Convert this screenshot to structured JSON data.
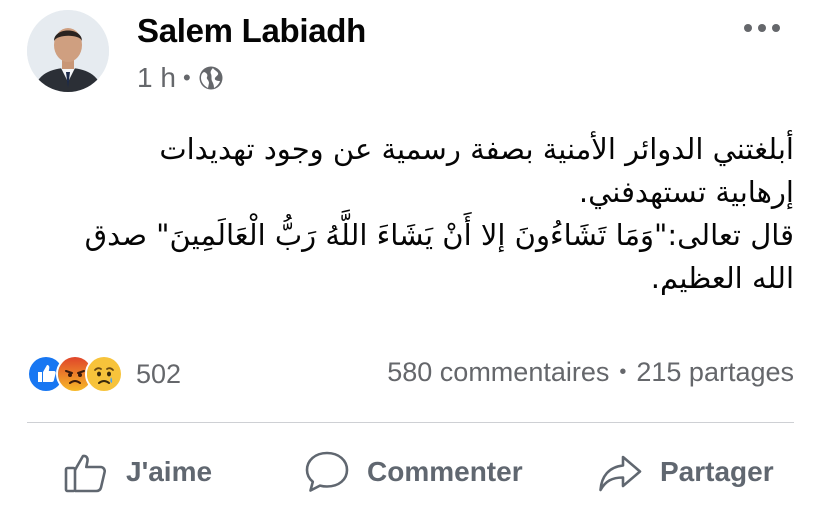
{
  "post": {
    "author": "Salem Labiadh",
    "time": "1 h",
    "separator": "•",
    "audience_icon": "globe-icon",
    "more_icon": "more-horizontal-icon",
    "body": "أبلغتني الدوائر الأمنية بصفة رسمية عن وجود تهديدات\nإرهابية تستهدفني.\nقال تعالى:\"وَمَا تَشَاءُونَ إلا أَنْ يَشَاءَ اللَّهُ رَبُّ الْعَالَمِينَ\" صدق\nالله العظيم."
  },
  "reactions": {
    "icons": [
      "like-reaction-icon",
      "angry-reaction-icon",
      "sad-reaction-icon"
    ],
    "count": "502",
    "colors": {
      "like": "#1877f2",
      "angry": "#f0682c",
      "sad": "#f7b928"
    }
  },
  "stats": {
    "comments": "580 commentaires",
    "separator": "•",
    "shares": "215 partages"
  },
  "actions": {
    "like": "J'aime",
    "comment": "Commenter",
    "share": "Partager"
  }
}
